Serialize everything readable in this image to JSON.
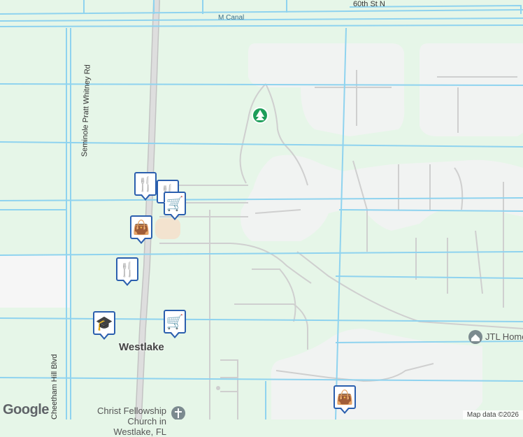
{
  "map": {
    "colors": {
      "land": "#e6f6e8",
      "canal": "#8fd3ef",
      "road": "#c9c9c9",
      "major_road": "#bdbdbd",
      "development": "#f2f2f2",
      "park_icon": "#1e9e5a",
      "pin_border": "#2b5fae",
      "pin_icon": "#123f72"
    },
    "labels": {
      "street_60th": "60th St N",
      "canal": "M Canal",
      "road_pratt": "Seminole Pratt Whitney Rd",
      "road_cheetham": "Cheetham Hill Blvd",
      "city": "Westlake",
      "place_church": "Christ Fellowship Church in Westlake, FL",
      "place_jtl": "JTL Homes"
    },
    "pins": [
      {
        "name": "restaurant-pin",
        "icon": "fork-knife-icon"
      },
      {
        "name": "restaurant-pin",
        "icon": "fork-knife-icon"
      },
      {
        "name": "grocery-pin",
        "icon": "shopping-cart-icon"
      },
      {
        "name": "shopping-pin",
        "icon": "shopping-bag-icon"
      },
      {
        "name": "restaurant-pin",
        "icon": "fork-knife-icon"
      },
      {
        "name": "school-pin",
        "icon": "graduation-cap-icon"
      },
      {
        "name": "grocery-pin",
        "icon": "shopping-cart-icon"
      },
      {
        "name": "shopping-pin",
        "icon": "shopping-bag-icon"
      }
    ],
    "footer": {
      "attribution": "Map data ©2026",
      "logo": "Google"
    }
  }
}
